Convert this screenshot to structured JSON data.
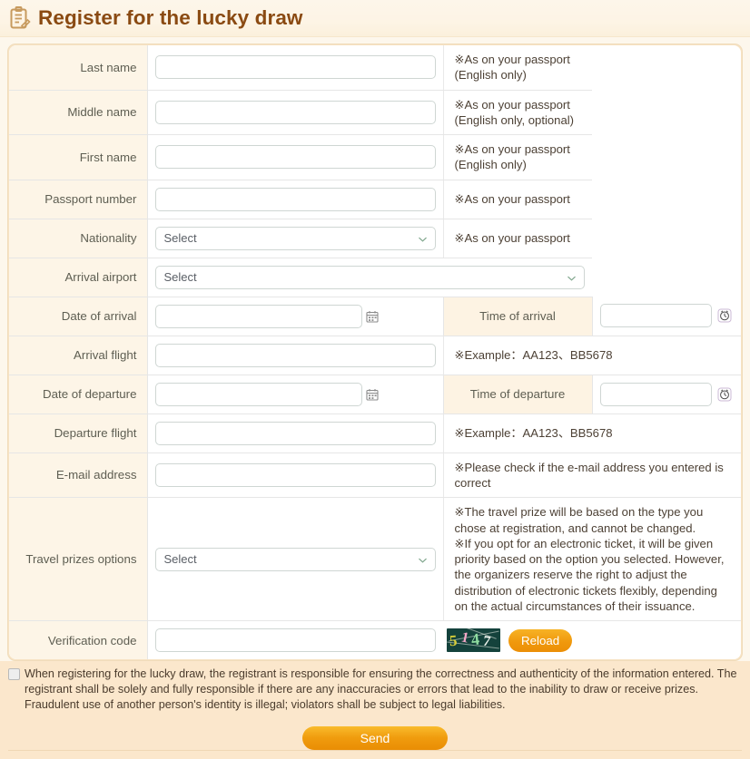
{
  "header": {
    "title": "Register for the lucky draw",
    "icon": "clipboard-pencil-icon"
  },
  "form": {
    "rows": [
      {
        "label": "Last name",
        "field": "text",
        "value": "",
        "hint": "※As on your passport (English only)"
      },
      {
        "label": "Middle name",
        "field": "text",
        "value": "",
        "hint": "※As on your passport (English only, optional)"
      },
      {
        "label": "First name",
        "field": "text",
        "value": "",
        "hint": "※As on your passport (English only)"
      },
      {
        "label": "Passport number",
        "field": "text",
        "value": "",
        "hint": "※As on your passport"
      },
      {
        "label": "Nationality",
        "field": "select",
        "value": "Select",
        "hint": "※As on your passport"
      },
      {
        "label": "Arrival airport",
        "field": "select",
        "value": "Select",
        "hint": ""
      },
      {
        "label": "Arrival flight",
        "field": "text",
        "value": "",
        "hint": "※Example：AA123、BB5678"
      },
      {
        "label": "Departure flight",
        "field": "text",
        "value": "",
        "hint": "※Example：AA123、BB5678"
      },
      {
        "label": "E-mail address",
        "field": "text",
        "value": "",
        "hint": "※Please check if the e-mail address you entered is correct"
      },
      {
        "label": "Travel prizes options",
        "field": "select",
        "value": "Select",
        "hint": "※The travel prize will be based on the type you chose at registration, and cannot be changed.\n※If you opt for an electronic ticket, it will be given priority based on the option you selected. However, the organizers reserve the right to adjust the distribution of electronic tickets flexibly, depending on the actual circumstances of their issuance."
      },
      {
        "label": "Verification code",
        "field": "captcha",
        "value": "",
        "hint": ""
      }
    ],
    "arrival_date": {
      "label": "Date of arrival",
      "date_value": "",
      "time_label": "Time of arrival",
      "time_value": "",
      "calendar_icon": "calendar-icon",
      "clock_icon": "clock-icon"
    },
    "departure_date": {
      "label": "Date of departure",
      "date_value": "",
      "time_label": "Time of departure",
      "time_value": "",
      "calendar_icon": "calendar-icon",
      "clock_icon": "clock-icon"
    },
    "select_placeholder": "Select",
    "chevron_icon": "chevron-down-icon"
  },
  "captcha": {
    "digits": "5147",
    "d1": "5",
    "d2": "1",
    "d3": "4",
    "d4": "7",
    "reload_label": "Reload",
    "background_color": "#14423c"
  },
  "footer": {
    "agreement_text": "When registering for the lucky draw, the registrant is responsible for ensuring the correctness and authenticity of the information entered. The registrant shall be solely and fully responsible if there are any inaccuracies or errors that lead to the inability to draw or receive prizes. Fraudulent use of another person's identity is illegal; violators shall be subject to legal liabilities.",
    "checkbox_checked": false,
    "send_label": "Send"
  },
  "colors": {
    "title": "#8a4a12",
    "accent_orange": "#f0990d",
    "label_bg": "#fdf5e7",
    "page_bg": "#fdf7ec",
    "footer_bg": "#fbe7cc"
  }
}
